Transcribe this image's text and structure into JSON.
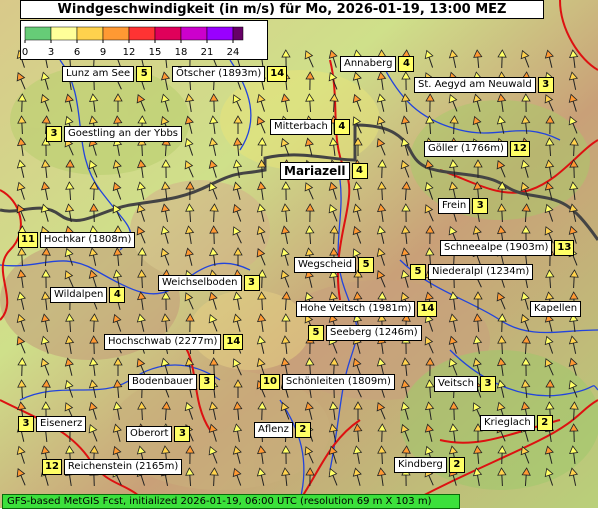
{
  "title": "Windgeschwindigkeit (in m/s) für Mo, 2026-01-19, 13:00 MEZ",
  "footer": "GFS-based MetGIS Fcst, initialized 2026-01-19, 06:00 UTC  (resolution 69 m X 103 m)",
  "legend": {
    "ticks": [
      "0",
      "3",
      "6",
      "9",
      "12",
      "15",
      "18",
      "21",
      "24"
    ],
    "colors": [
      "#66cc77",
      "#ffff99",
      "#ffd24d",
      "#ff9933",
      "#ff3333",
      "#e0005a",
      "#cc00cc",
      "#9900ff",
      "#660066"
    ]
  },
  "places": [
    {
      "name": "Lunz am See",
      "value": "5",
      "value_side": "right"
    },
    {
      "name": "Ötscher (1893m)",
      "value": "14",
      "value_side": "right"
    },
    {
      "name": "Annaberg",
      "value": "4",
      "value_side": "right"
    },
    {
      "name": "St. Aegyd am Neuwald",
      "value": "3",
      "value_side": "right"
    },
    {
      "name": "Goestling an der Ybbs",
      "value": "3",
      "value_side": "left"
    },
    {
      "name": "Mitterbach",
      "value": "4",
      "value_side": "right"
    },
    {
      "name": "Göller (1766m)",
      "value": "12",
      "value_side": "right"
    },
    {
      "name": "Mariazell",
      "value": "4",
      "value_side": "right",
      "big": true
    },
    {
      "name": "Frein",
      "value": "3",
      "value_side": "right"
    },
    {
      "name": "Hochkar (1808m)",
      "value": "11",
      "value_side": "left"
    },
    {
      "name": "Schneealpe (1903m)",
      "value": "13",
      "value_side": "right"
    },
    {
      "name": "Wegscheid",
      "value": "5",
      "value_side": "right"
    },
    {
      "name": "Niederalpl (1234m)",
      "value": "5",
      "value_side": "left"
    },
    {
      "name": "Weichselboden",
      "value": "3",
      "value_side": "right"
    },
    {
      "name": "Wildalpen",
      "value": "4",
      "value_side": "right"
    },
    {
      "name": "Hohe Veitsch (1981m)",
      "value": "14",
      "value_side": "right"
    },
    {
      "name": "Kapellen",
      "value": "",
      "value_side": "none"
    },
    {
      "name": "Seeberg (1246m)",
      "value": "5",
      "value_side": "left"
    },
    {
      "name": "Hochschwab (2277m)",
      "value": "14",
      "value_side": "right"
    },
    {
      "name": "Bodenbauer",
      "value": "3",
      "value_side": "right"
    },
    {
      "name": "Schönleiten (1809m)",
      "value": "10",
      "value_side": "left"
    },
    {
      "name": "Veitsch",
      "value": "3",
      "value_side": "right"
    },
    {
      "name": "Eisenerz",
      "value": "3",
      "value_side": "left"
    },
    {
      "name": "Oberort",
      "value": "3",
      "value_side": "right"
    },
    {
      "name": "Aflenz",
      "value": "2",
      "value_side": "right"
    },
    {
      "name": "Krieglach",
      "value": "2",
      "value_side": "right"
    },
    {
      "name": "Reichenstein (2165m)",
      "value": "12",
      "value_side": "left"
    },
    {
      "name": "Kindberg",
      "value": "2",
      "value_side": "right"
    }
  ]
}
